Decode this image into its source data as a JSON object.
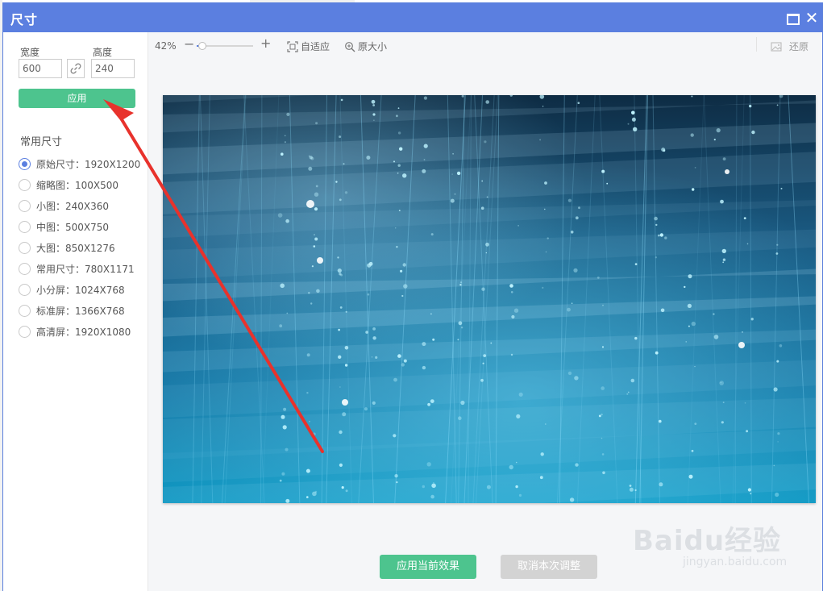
{
  "dialog": {
    "title": "尺寸"
  },
  "left_panel": {
    "width_label": "宽度",
    "height_label": "高度",
    "width_value": "600",
    "height_value": "240",
    "apply_label": "应用",
    "presets_title": "常用尺寸",
    "presets": [
      {
        "label": "原始尺寸：1920X1200",
        "checked": true
      },
      {
        "label": "缩略图：100X500",
        "checked": false
      },
      {
        "label": "小图：240X360",
        "checked": false
      },
      {
        "label": "中图：500X750",
        "checked": false
      },
      {
        "label": "大图：850X1276",
        "checked": false
      },
      {
        "label": "常用尺寸：780X1171",
        "checked": false
      },
      {
        "label": "小分屏：1024X768",
        "checked": false
      },
      {
        "label": "标准屏：1366X768",
        "checked": false
      },
      {
        "label": "高清屏：1920X1080",
        "checked": false
      }
    ]
  },
  "toolbar": {
    "zoom_value": "42%",
    "zoom_level": 0.1,
    "fit_label": "自适应",
    "original_size_label": "原大小",
    "restore_label": "还原"
  },
  "footer": {
    "apply_effect_label": "应用当前效果",
    "cancel_adjust_label": "取消本次调整"
  },
  "watermark": {
    "brand": "Baidu经验",
    "url": "jingyan.baidu.com"
  },
  "colors": {
    "title_bar": "#5b7fe0",
    "accent_green": "#4dc48e",
    "arrow_red": "#e8322c"
  },
  "icons": {
    "maximize": "maximize-icon",
    "close": "close-icon",
    "link": "link-icon",
    "fit": "fit-icon",
    "original_size": "magnify-icon",
    "restore": "image-icon"
  }
}
